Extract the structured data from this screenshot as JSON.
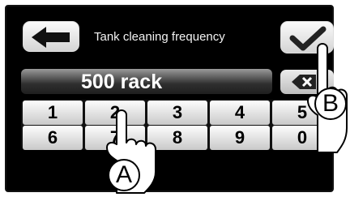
{
  "header": {
    "title": "Tank cleaning frequency"
  },
  "display": {
    "value": "500 rack"
  },
  "keypad": {
    "row1": [
      "1",
      "2",
      "3",
      "4",
      "5"
    ],
    "row2": [
      "6",
      "7",
      "8",
      "9",
      "0"
    ]
  },
  "callouts": {
    "a": "A",
    "b": "B"
  },
  "icons": {
    "back": "left-arrow-icon",
    "confirm": "checkmark-icon",
    "clear": "backspace-icon"
  }
}
